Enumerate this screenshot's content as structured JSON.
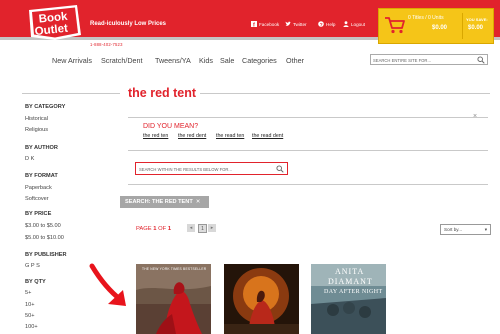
{
  "header": {
    "logo_line1": "Book",
    "logo_line2": "Outlet",
    "tagline": "Read-iculously Low Prices",
    "phone": "1-888-402-7523",
    "links": [
      "Facebook",
      "Twitter",
      "Help",
      "Logout"
    ],
    "cart": {
      "count_text": "0 Titles / 0 Units",
      "total": "$0.00",
      "you_save_label": "YOU SAVE:",
      "you_save_value": "$0.00"
    },
    "colors": {
      "brand_red": "#e1232c",
      "cart_yellow": "#f5c518"
    }
  },
  "nav": {
    "items": [
      "New Arrivals",
      "Scratch/Dent",
      "Tweens/YA",
      "Kids",
      "Sale",
      "Categories",
      "Other"
    ],
    "search_placeholder": "SEARCH ENTIRE SITE FOR..."
  },
  "page_title": "the red tent",
  "sidebar": {
    "category": {
      "heading": "BY CATEGORY",
      "items": [
        "Historical",
        "Religious"
      ]
    },
    "author": {
      "heading": "BY AUTHOR",
      "items": [
        "D K"
      ]
    },
    "format": {
      "heading": "BY FORMAT",
      "items": [
        "Paperback",
        "Softcover"
      ]
    },
    "price": {
      "heading": "BY PRICE",
      "items": [
        "$3.00 to $5.00",
        "$5.00 to $10.00"
      ]
    },
    "publisher": {
      "heading": "BY PUBLISHER",
      "items": [
        "G P S"
      ]
    },
    "qty": {
      "heading": "BY QTY",
      "items": [
        "5+",
        "10+",
        "50+",
        "100+"
      ]
    }
  },
  "did_you_mean": {
    "label": "DID YOU MEAN?",
    "links": [
      "the red ten",
      "the red dent",
      "the read ten",
      "the read dent"
    ],
    "close": "×"
  },
  "results_search": {
    "placeholder": "SEARCH WITHIN THE RESULTS BELOW FOR..."
  },
  "search_chip": {
    "label": "SEARCH: THE RED TENT",
    "remove": "✕"
  },
  "pagination": {
    "prefix": "PAGE ",
    "current": "1",
    "of_text": " OF ",
    "total": "1",
    "prev": "◂",
    "next": "▸"
  },
  "sort": {
    "selected": "Sort by...",
    "caret": "▾"
  },
  "books": [
    {
      "cover_text": "THE NEW YORK TIMES BESTSELLER"
    },
    {
      "cover_text": ""
    },
    {
      "cover_text_1": "ANITA",
      "cover_text_2": "DIAMANT",
      "cover_text_3": "DAY AFTER NIGHT"
    }
  ],
  "icons": [
    "logo",
    "facebook-icon",
    "twitter-icon",
    "help-icon",
    "logout-icon",
    "cart-icon",
    "search-icon",
    "close-icon",
    "arrow-annotation"
  ]
}
